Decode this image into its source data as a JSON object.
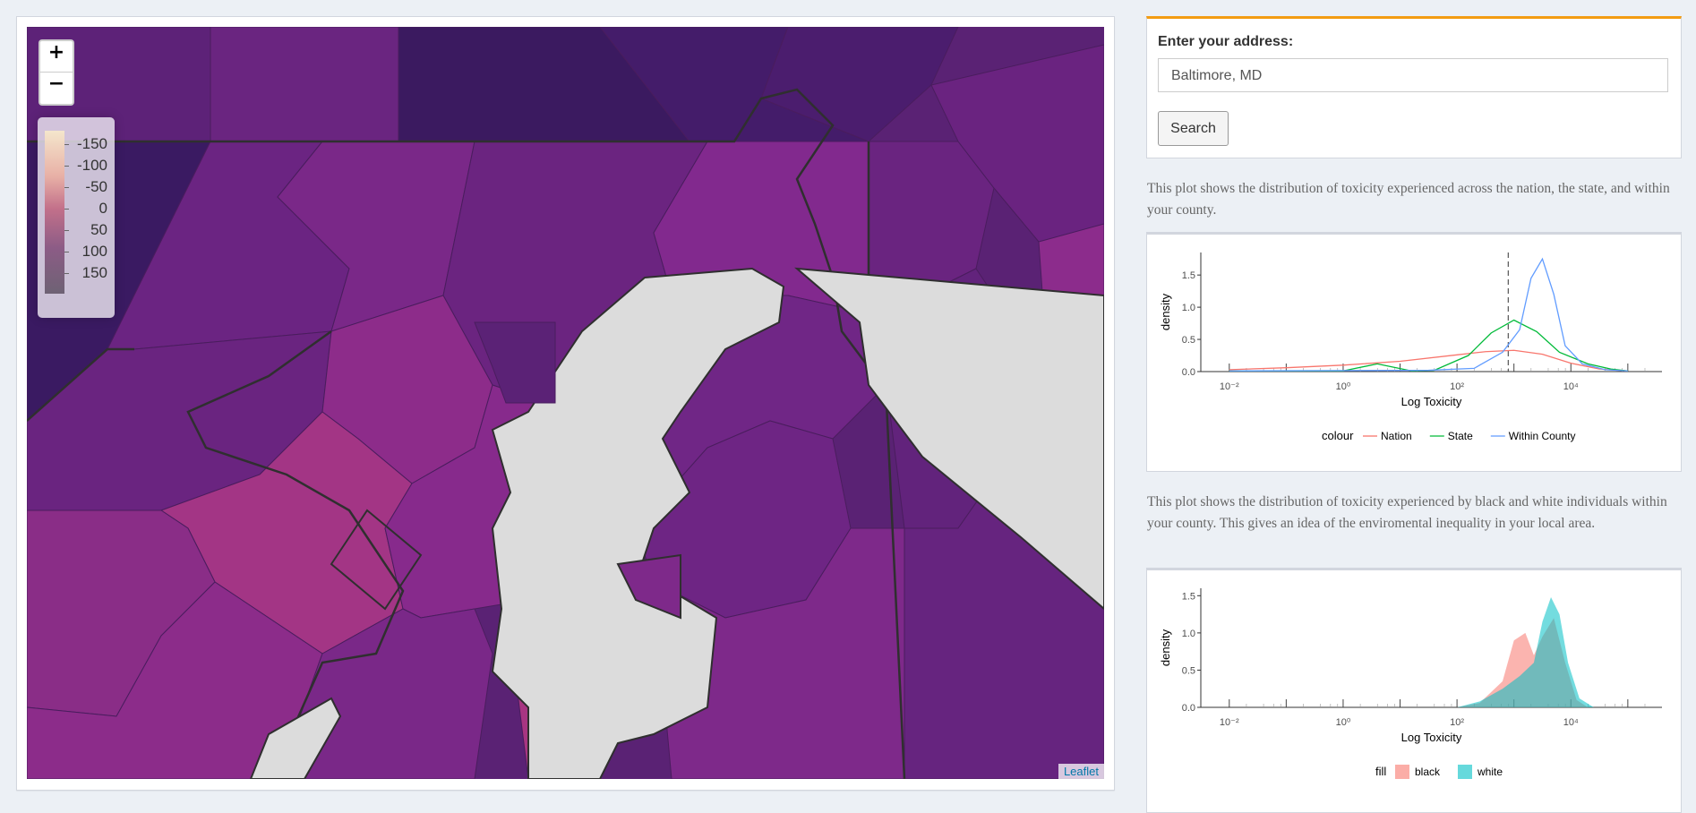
{
  "map": {
    "zoom_in": "+",
    "zoom_out": "−",
    "legend": {
      "labels": [
        "-150",
        "-100",
        "-50",
        "0",
        "50",
        "100",
        "150"
      ]
    },
    "attribution": "Leaflet"
  },
  "search": {
    "label": "Enter your address:",
    "value": "Baltimore, MD",
    "button": "Search"
  },
  "plot1": {
    "description": "This plot shows the distribution of toxicity experienced across the nation, the state, and within your county.",
    "legend_title": "colour",
    "series": [
      {
        "name": "Nation",
        "color": "#f8766d"
      },
      {
        "name": "State",
        "color": "#00ba38"
      },
      {
        "name": "Within County",
        "color": "#619cff"
      }
    ]
  },
  "plot2": {
    "description": "This plot shows the distribution of toxicity experienced by black and white individuals within your county. This gives an idea of the enviromental inequality in your local area.",
    "legend_title": "fill",
    "series": [
      {
        "name": "black",
        "color": "#f8766d"
      },
      {
        "name": "white",
        "color": "#00bfc4"
      }
    ]
  },
  "chart_data": [
    {
      "type": "line",
      "xlabel": "Log Toxicity",
      "ylabel": "density",
      "x_ticks": [
        "10⁻²",
        "10⁰",
        "10²",
        "10⁴"
      ],
      "y_ticks": [
        "0.0",
        "0.5",
        "1.0",
        "1.5"
      ],
      "ylim": [
        0,
        1.85
      ],
      "x_scale": "log10",
      "vline_x": 2.9,
      "series": [
        {
          "name": "Nation",
          "x": [
            -2,
            -1,
            0,
            1,
            2,
            2.5,
            3,
            3.5,
            4,
            4.5,
            5
          ],
          "y": [
            0.03,
            0.06,
            0.1,
            0.16,
            0.26,
            0.31,
            0.33,
            0.27,
            0.13,
            0.04,
            0.01
          ]
        },
        {
          "name": "State",
          "x": [
            -2,
            0,
            0.6,
            1.2,
            1.6,
            2.2,
            2.6,
            3,
            3.4,
            3.8,
            4.3,
            4.7,
            5
          ],
          "y": [
            0.01,
            0.01,
            0.12,
            0.01,
            0.02,
            0.25,
            0.6,
            0.8,
            0.62,
            0.3,
            0.12,
            0.04,
            0.01
          ]
        },
        {
          "name": "Within County",
          "x": [
            -2,
            1.5,
            2.3,
            2.8,
            3.1,
            3.3,
            3.5,
            3.7,
            3.9,
            4.2,
            4.6,
            5
          ],
          "y": [
            0.01,
            0.02,
            0.05,
            0.3,
            0.65,
            1.45,
            1.75,
            1.2,
            0.4,
            0.12,
            0.03,
            0.01
          ]
        }
      ]
    },
    {
      "type": "area",
      "xlabel": "Log Toxicity",
      "ylabel": "density",
      "x_ticks": [
        "10⁻²",
        "10⁰",
        "10²",
        "10⁴"
      ],
      "y_ticks": [
        "0.0",
        "0.5",
        "1.0",
        "1.5"
      ],
      "ylim": [
        0,
        1.6
      ],
      "x_scale": "log10",
      "series": [
        {
          "name": "black",
          "x": [
            2.0,
            2.4,
            2.8,
            3.0,
            3.2,
            3.35,
            3.5,
            3.7,
            3.9,
            4.1,
            4.3
          ],
          "y": [
            0.0,
            0.06,
            0.35,
            0.9,
            1.0,
            0.7,
            0.95,
            1.2,
            0.6,
            0.1,
            0.0
          ]
        },
        {
          "name": "white",
          "x": [
            2.0,
            2.4,
            2.8,
            3.1,
            3.35,
            3.5,
            3.65,
            3.8,
            3.95,
            4.15,
            4.4
          ],
          "y": [
            0.0,
            0.08,
            0.25,
            0.42,
            0.6,
            1.15,
            1.48,
            1.25,
            0.6,
            0.12,
            0.0
          ]
        }
      ]
    }
  ]
}
